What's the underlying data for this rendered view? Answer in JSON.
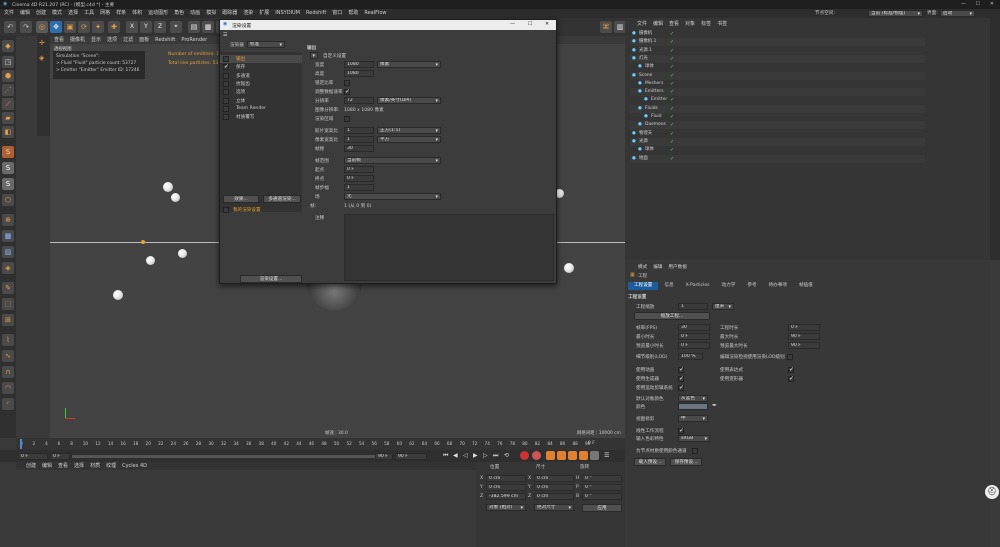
{
  "window": {
    "title": "Cinema 4D R21.207 (RC) - [模型.c4d *] - 主要",
    "controls": [
      "—",
      "☐",
      "✕"
    ]
  },
  "menubar": {
    "items": [
      "文件",
      "编辑",
      "创建",
      "模式",
      "选择",
      "工具",
      "网格",
      "样条",
      "体积",
      "运动图形",
      "角色",
      "动画",
      "模拟",
      "跟踪器",
      "渲染",
      "扩展",
      "INSYDIUM",
      "Redshift",
      "窗口",
      "帮助",
      "RealFlow"
    ],
    "node_space_label": "节点空间:",
    "node_space_value": "当前 (标准/物理)",
    "layout_label": "界面:",
    "layout_value": "启动"
  },
  "viewport": {
    "menu": [
      "查看",
      "摄像机",
      "显示",
      "选项",
      "过滤",
      "面板",
      "Redshift",
      "ProRender"
    ],
    "label": "透视视图",
    "sim_title": "Simulation \"Scene\":",
    "sim_fluid": "> Fluid \"Fluid\" particle count: 53727",
    "sim_emitter": "> Emitter \"Emitter\" Emitter ID: 17246",
    "num_emitters": "Number of emitters: 1",
    "total_particles": "Total live particles: 53727",
    "speed": "帧速 : 30.0",
    "grid": "网格间距 : 10000 cm"
  },
  "timeline": {
    "ticks": [
      "0",
      "2",
      "4",
      "6",
      "8",
      "10",
      "12",
      "14",
      "16",
      "18",
      "20",
      "22",
      "24",
      "26",
      "28",
      "30",
      "32",
      "34",
      "36",
      "38",
      "40",
      "42",
      "44",
      "46",
      "48",
      "50",
      "52",
      "54",
      "56",
      "58",
      "60",
      "62",
      "64",
      "66",
      "68",
      "70",
      "72",
      "74",
      "76",
      "78",
      "80",
      "82",
      "84",
      "86",
      "88",
      "90"
    ],
    "end_label": "0 F",
    "start_field": "0 F",
    "min_field": "0 F",
    "max_field": "90 F",
    "end_field": "90 F"
  },
  "materials": {
    "menu": [
      "创建",
      "编辑",
      "查看",
      "选择",
      "材质",
      "纹理",
      "Cycles 4D"
    ]
  },
  "coords": {
    "headers": [
      "位置",
      "尺寸",
      "旋转"
    ],
    "rows": [
      {
        "axis": "X",
        "pos": "0 cm",
        "size": "0 cm",
        "rot_axis": "H",
        "rot": "0 °"
      },
      {
        "axis": "Y",
        "pos": "0 cm",
        "size": "0 cm",
        "rot_axis": "P",
        "rot": "0 °"
      },
      {
        "axis": "Z",
        "pos": "-382.599 cm",
        "size": "0 cm",
        "rot_axis": "B",
        "rot": "0 °"
      }
    ],
    "mode": "对象 (相对)",
    "size_mode": "绝对尺寸",
    "apply": "应用"
  },
  "objects": {
    "menu": [
      "文件",
      "编辑",
      "查看",
      "对象",
      "标签",
      "书签"
    ],
    "items": [
      {
        "name": "摄像机",
        "indent": 0
      },
      {
        "name": "摄像机.1",
        "indent": 0
      },
      {
        "name": "光源.1",
        "indent": 0
      },
      {
        "name": "灯光",
        "indent": 0
      },
      {
        "name": "球体",
        "indent": 1
      },
      {
        "name": "Scene",
        "indent": 0
      },
      {
        "name": "Meshers",
        "indent": 1
      },
      {
        "name": "Emitters",
        "indent": 1
      },
      {
        "name": "Emitter",
        "indent": 2
      },
      {
        "name": "Fluids",
        "indent": 1
      },
      {
        "name": "Fluid",
        "indent": 2
      },
      {
        "name": "Daemons",
        "indent": 1
      },
      {
        "name": "物理天",
        "indent": 0
      },
      {
        "name": "光源",
        "indent": 0
      },
      {
        "name": "球体",
        "indent": 1
      },
      {
        "name": "地面",
        "indent": 0
      }
    ]
  },
  "attributes": {
    "menu": [
      "模式",
      "编辑",
      "用户数据"
    ],
    "title": "工程",
    "tabs": [
      "工程设置",
      "信息",
      "X-Particles",
      "动力学",
      "参考",
      "待办事项",
      "帧插值"
    ],
    "section": "工程设置",
    "scale_label": "工程缩放",
    "scale_value": "1",
    "scale_unit": "厘米",
    "scale_button": "缩放工程...",
    "left": [
      {
        "label": "帧率(FPS)",
        "value": "30"
      },
      {
        "label": "最小时长",
        "value": "0 F"
      },
      {
        "label": "预览最小时长",
        "value": "0 F"
      }
    ],
    "right": [
      {
        "label": "工程时长",
        "value": "0 F"
      },
      {
        "label": "最大时长",
        "value": "90 F"
      },
      {
        "label": "预览最大时长",
        "value": "90 F"
      }
    ],
    "lod_label": "细节级别(LOD)",
    "lod_value": "100 %",
    "lod_check": "编辑渲染检视使用渲染LOD级别",
    "checks_left": [
      {
        "label": "使用动画",
        "on": true
      },
      {
        "label": "使用生成器",
        "on": true
      },
      {
        "label": "使用运动剪辑系统",
        "on": true
      }
    ],
    "checks_right": [
      {
        "label": "使用表达式",
        "on": true
      },
      {
        "label": "使用变形器",
        "on": true
      }
    ],
    "default_color_label": "默认对象颜色",
    "default_color_value": "灰蓝色",
    "color_label": "颜色",
    "view_clip_label": "视图修剪",
    "view_clip_value": "中",
    "linear_label": "线性工作流程",
    "input_color_label": "输入色彩特性",
    "input_color_value": "sRGB",
    "node_color_label": "为节点材质使用颜色通道",
    "load_button": "载入预设...",
    "save_button": "保存预设..."
  },
  "render_dialog": {
    "title": "渲染设置",
    "renderer_label": "渲染器",
    "renderer_value": "标准",
    "nav": [
      {
        "label": "输出",
        "checked": false,
        "active": true
      },
      {
        "label": "保存",
        "checked": true,
        "active": false
      },
      {
        "label": "多通道",
        "checked": false,
        "active": false
      },
      {
        "label": "抗锯齿",
        "checked": false,
        "active": false
      },
      {
        "label": "选项",
        "checked": false,
        "active": false
      },
      {
        "label": "立体",
        "checked": false,
        "active": false
      },
      {
        "label": "Team Render",
        "checked": false,
        "active": false
      },
      {
        "label": "材质覆写",
        "checked": false,
        "active": false
      }
    ],
    "effect_button": "效果...",
    "multipass_button": "多通道渲染...",
    "my_settings": "我的渲染设置",
    "render_button": "渲染设置...",
    "section": "输出",
    "preset": "自定义设置",
    "width_label": "宽度",
    "width_value": "1080",
    "width_unit": "像素",
    "height_label": "高度",
    "height_value": "1080",
    "lock_label": "锁定比率",
    "adjust_label": "调整数据速率",
    "res_label": "分辨率",
    "res_value": "72",
    "res_unit": "像素/英寸(DPI)",
    "imgres_label": "图像分辨率:",
    "imgres_value": "1080 x 1080 像素",
    "region_label": "渲染区域",
    "film_label": "胶片宽高比",
    "film_value": "1",
    "film_ratio": "正方(1:1)",
    "pixel_label": "像素宽高比",
    "pixel_value": "1",
    "pixel_ratio": "平方",
    "fps_label": "帧频",
    "fps_value": "30",
    "range_label": "帧范围",
    "range_value": "当前帧",
    "start_label": "起点",
    "start_value": "0 F",
    "end_label": "终点",
    "end_value": "0 F",
    "step_label": "帧步幅",
    "step_value": "1",
    "field_label": "场",
    "field_value": "无",
    "frames_label": "帧:",
    "frames_value": "1 (从 0 到 0)",
    "note_label": "注释"
  }
}
